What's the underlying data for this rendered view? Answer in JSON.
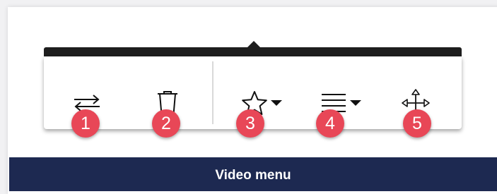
{
  "toolbar": {
    "tools": [
      {
        "icon": "swap-arrows-icon",
        "badge": "1"
      },
      {
        "icon": "trash-icon",
        "badge": "2"
      },
      {
        "icon": "star-icon",
        "badge": "3",
        "has_dropdown": true
      },
      {
        "icon": "align-lines-icon",
        "badge": "4",
        "has_dropdown": true
      },
      {
        "icon": "move-arrows-icon",
        "badge": "5"
      }
    ]
  },
  "caption": {
    "text": "Video menu"
  },
  "colors": {
    "badge": "#e84757",
    "caption_bg": "#1d2951",
    "toolbar_top": "#1e1e1e",
    "icon": "#111111"
  }
}
